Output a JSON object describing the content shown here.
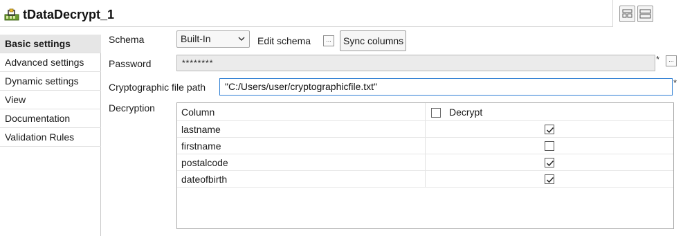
{
  "header": {
    "title": "tDataDecrypt_1",
    "icon": "component-icon"
  },
  "sidebar": {
    "items": [
      {
        "label": "Basic settings",
        "active": true
      },
      {
        "label": "Advanced settings",
        "active": false
      },
      {
        "label": "Dynamic settings",
        "active": false
      },
      {
        "label": "View",
        "active": false
      },
      {
        "label": "Documentation",
        "active": false
      },
      {
        "label": "Validation Rules",
        "active": false
      }
    ]
  },
  "form": {
    "schema_label": "Schema",
    "schema_value": "Built-In",
    "edit_schema_label": "Edit schema",
    "edit_schema_button": "...",
    "sync_columns_label": "Sync columns",
    "password_label": "Password",
    "password_value": "********",
    "password_required": "*",
    "password_button": "...",
    "crypto_label": "Cryptographic file path",
    "crypto_value": "\"C:/Users/user/cryptographicfile.txt\"",
    "crypto_required": "*",
    "decryption_label": "Decryption"
  },
  "table": {
    "headers": {
      "column": "Column",
      "decrypt": "Decrypt"
    },
    "header_checked": false,
    "rows": [
      {
        "column": "lastname",
        "decrypt": true
      },
      {
        "column": "firstname",
        "decrypt": false
      },
      {
        "column": "postalcode",
        "decrypt": true
      },
      {
        "column": "dateofbirth",
        "decrypt": true
      }
    ]
  },
  "colors": {
    "accent_border": "#2b7cd3",
    "active_sidebar": "#e6e6e6"
  }
}
